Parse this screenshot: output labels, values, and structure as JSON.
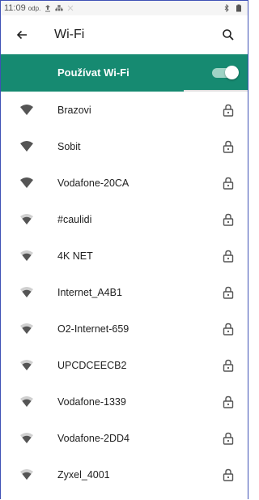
{
  "status_bar": {
    "time": "11:09",
    "ampm": "odp."
  },
  "toolbar": {
    "title": "Wi-Fi"
  },
  "wifi_master": {
    "label": "Používat Wi-Fi",
    "enabled": true
  },
  "networks": [
    {
      "name": "Brazovi",
      "signal": "full-signal-icon",
      "secured": true
    },
    {
      "name": "Sobit",
      "signal": "full-signal-icon",
      "secured": true
    },
    {
      "name": "Vodafone-20CA",
      "signal": "full-signal-icon",
      "secured": true
    },
    {
      "name": "#caulidi",
      "signal": "medium-signal-icon",
      "secured": true
    },
    {
      "name": "4K NET",
      "signal": "medium-signal-icon",
      "secured": true
    },
    {
      "name": "Internet_A4B1",
      "signal": "medium-signal-icon",
      "secured": true
    },
    {
      "name": "O2-Internet-659",
      "signal": "medium-signal-icon",
      "secured": true
    },
    {
      "name": "UPCDCEECB2",
      "signal": "medium-signal-icon",
      "secured": true
    },
    {
      "name": "Vodafone-1339",
      "signal": "medium-signal-icon",
      "secured": true
    },
    {
      "name": "Vodafone-2DD4",
      "signal": "medium-signal-icon",
      "secured": true
    },
    {
      "name": "Zyxel_4001",
      "signal": "medium-signal-icon",
      "secured": true
    }
  ],
  "colors": {
    "accent": "#168a71",
    "frame": "#3f51b5"
  }
}
